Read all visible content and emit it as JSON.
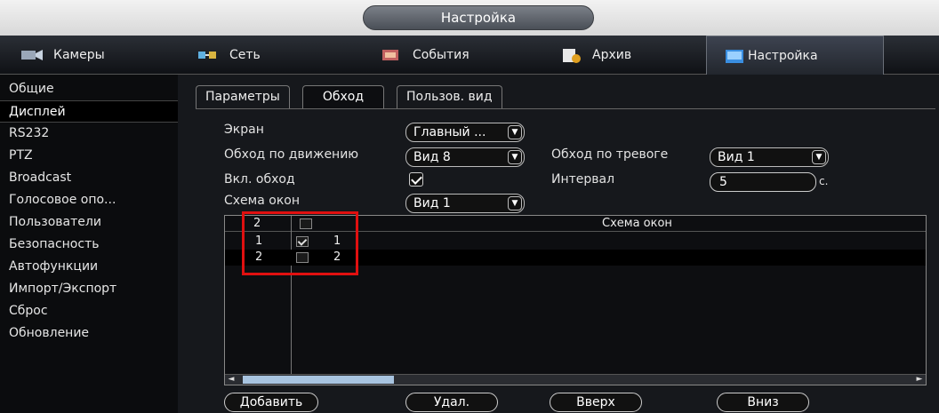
{
  "window": {
    "title": "Настройка"
  },
  "nav": [
    {
      "label": "Камеры",
      "icon": "camera-icon",
      "active": false
    },
    {
      "label": "Сеть",
      "icon": "network-icon",
      "active": false
    },
    {
      "label": "События",
      "icon": "events-icon",
      "active": false
    },
    {
      "label": "Архив",
      "icon": "archive-icon",
      "active": false
    },
    {
      "label": "Настройка",
      "icon": "settings-icon",
      "active": true
    }
  ],
  "sidebar": {
    "items": [
      {
        "label": "Общие"
      },
      {
        "label": "Дисплей",
        "active": true
      },
      {
        "label": "RS232"
      },
      {
        "label": "PTZ"
      },
      {
        "label": "Broadcast"
      },
      {
        "label": "Голосовое опо..."
      },
      {
        "label": "Пользователи"
      },
      {
        "label": "Безопасность"
      },
      {
        "label": "Автофункции"
      },
      {
        "label": "Импорт/Экспорт"
      },
      {
        "label": "Сброс"
      },
      {
        "label": "Обновление"
      }
    ]
  },
  "tabs": [
    {
      "label": "Параметры"
    },
    {
      "label": "Обход",
      "active": true
    },
    {
      "label": "Пользов. вид"
    }
  ],
  "form": {
    "screen_label": "Экран",
    "screen_value": "Главный ...",
    "motion_tour_label": "Обход по движению",
    "motion_tour_value": "Вид 8",
    "alarm_tour_label": "Обход по тревоге",
    "alarm_tour_value": "Вид 1",
    "enable_tour_label": "Вкл. обход",
    "enable_tour_checked": true,
    "interval_label": "Интервал",
    "interval_value": "5",
    "interval_unit": "с.",
    "window_scheme_label": "Схема окон",
    "window_scheme_value": "Вид 1"
  },
  "table": {
    "header_count": "2",
    "header_title": "Схема окон",
    "rows": [
      {
        "index": "1",
        "checked": true,
        "value": "1"
      },
      {
        "index": "2",
        "checked": false,
        "value": "2"
      }
    ]
  },
  "buttons": {
    "add": "Добавить",
    "delete": "Удал.",
    "up": "Вверх",
    "down": "Вниз"
  },
  "colors": {
    "highlight": "#e01010",
    "scroll_thumb": "#a8c4e0"
  }
}
